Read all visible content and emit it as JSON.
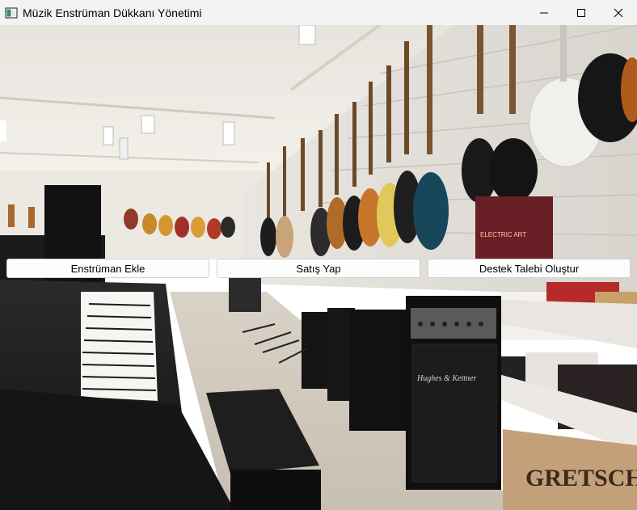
{
  "window": {
    "title": "Müzik Enstrüman Dükkanı Yönetimi"
  },
  "actions": {
    "add_instrument": "Enstrüman Ekle",
    "make_sale": "Satış Yap",
    "create_support_ticket": "Destek Talebi Oluştur"
  },
  "background": {
    "amp_brand": "Hughes & Kettner",
    "box_brand": "GRETSCH",
    "poster_text": "ELECTRIC ART"
  },
  "colors": {
    "titlebar": "#f3f3f3",
    "button_bg": "#fdfdfd",
    "button_border": "#d0d0d0"
  }
}
